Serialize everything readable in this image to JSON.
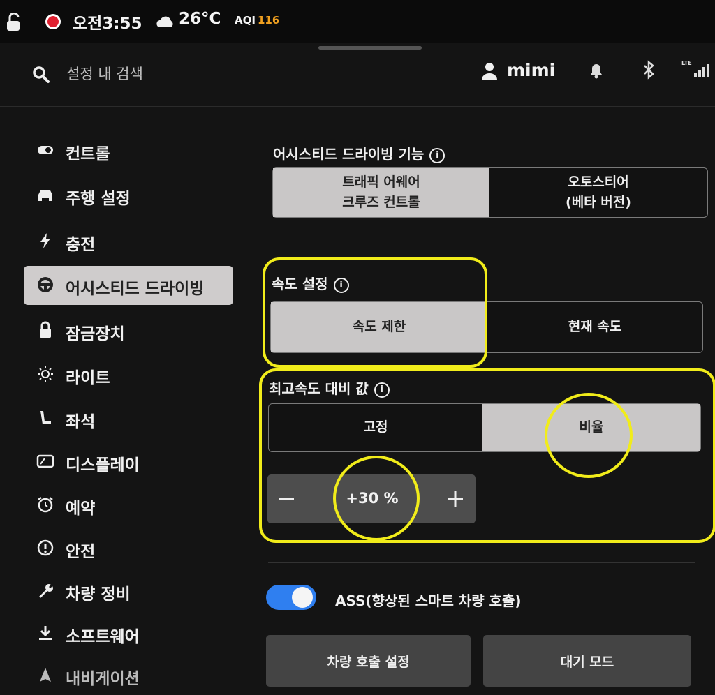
{
  "status_bar": {
    "time": "오전3:55",
    "temperature": "26°C",
    "aqi_label": "AQI",
    "aqi_value": "116",
    "aqi_color": "#f0a020"
  },
  "header": {
    "search_placeholder": "설정 내 검색",
    "username": "mimi",
    "icons": [
      "search-icon",
      "user-icon",
      "bell-icon",
      "bluetooth-icon",
      "lte-signal-icon"
    ]
  },
  "sidebar": {
    "items": [
      {
        "label": "컨트롤",
        "icon": "toggle-icon",
        "active": false
      },
      {
        "label": "주행 설정",
        "icon": "car-icon",
        "active": false
      },
      {
        "label": "충전",
        "icon": "bolt-icon",
        "active": false
      },
      {
        "label": "어시스티드 드라이빙",
        "icon": "steering-wheel-icon",
        "active": true
      },
      {
        "label": "잠금장치",
        "icon": "lock-icon",
        "active": false
      },
      {
        "label": "라이트",
        "icon": "light-icon",
        "active": false
      },
      {
        "label": "좌석",
        "icon": "seat-icon",
        "active": false
      },
      {
        "label": "디스플레이",
        "icon": "display-icon",
        "active": false
      },
      {
        "label": "예약",
        "icon": "alarm-icon",
        "active": false
      },
      {
        "label": "안전",
        "icon": "safety-icon",
        "active": false
      },
      {
        "label": "차량 정비",
        "icon": "wrench-icon",
        "active": false
      },
      {
        "label": "소프트웨어",
        "icon": "download-icon",
        "active": false
      },
      {
        "label": "내비게이션",
        "icon": "navigation-icon",
        "active": false
      }
    ]
  },
  "main": {
    "assisted_driving": {
      "title": "어시스티드 드라이빙 기능",
      "options": [
        "트래픽 어웨어\n크루즈 컨트롤",
        "오토스티어\n(베타 버전)"
      ],
      "selected": 0
    },
    "speed_setting": {
      "title": "속도 설정",
      "options": [
        "속도 제한",
        "현재 속도"
      ],
      "selected": 0
    },
    "speed_offset": {
      "title": "최고속도 대비 값",
      "options": [
        "고정",
        "비율"
      ],
      "selected": 1,
      "value": "+30 %",
      "minus": "−",
      "plus": "+"
    },
    "ass": {
      "label": "ASS(향상된 스마트 차량 호출)",
      "enabled": true
    },
    "buttons": {
      "summon_settings": "차량 호출 설정",
      "standby": "대기 모드"
    }
  },
  "annotation_color": "#f1ec1a",
  "accent_color": "#2f7ff0"
}
